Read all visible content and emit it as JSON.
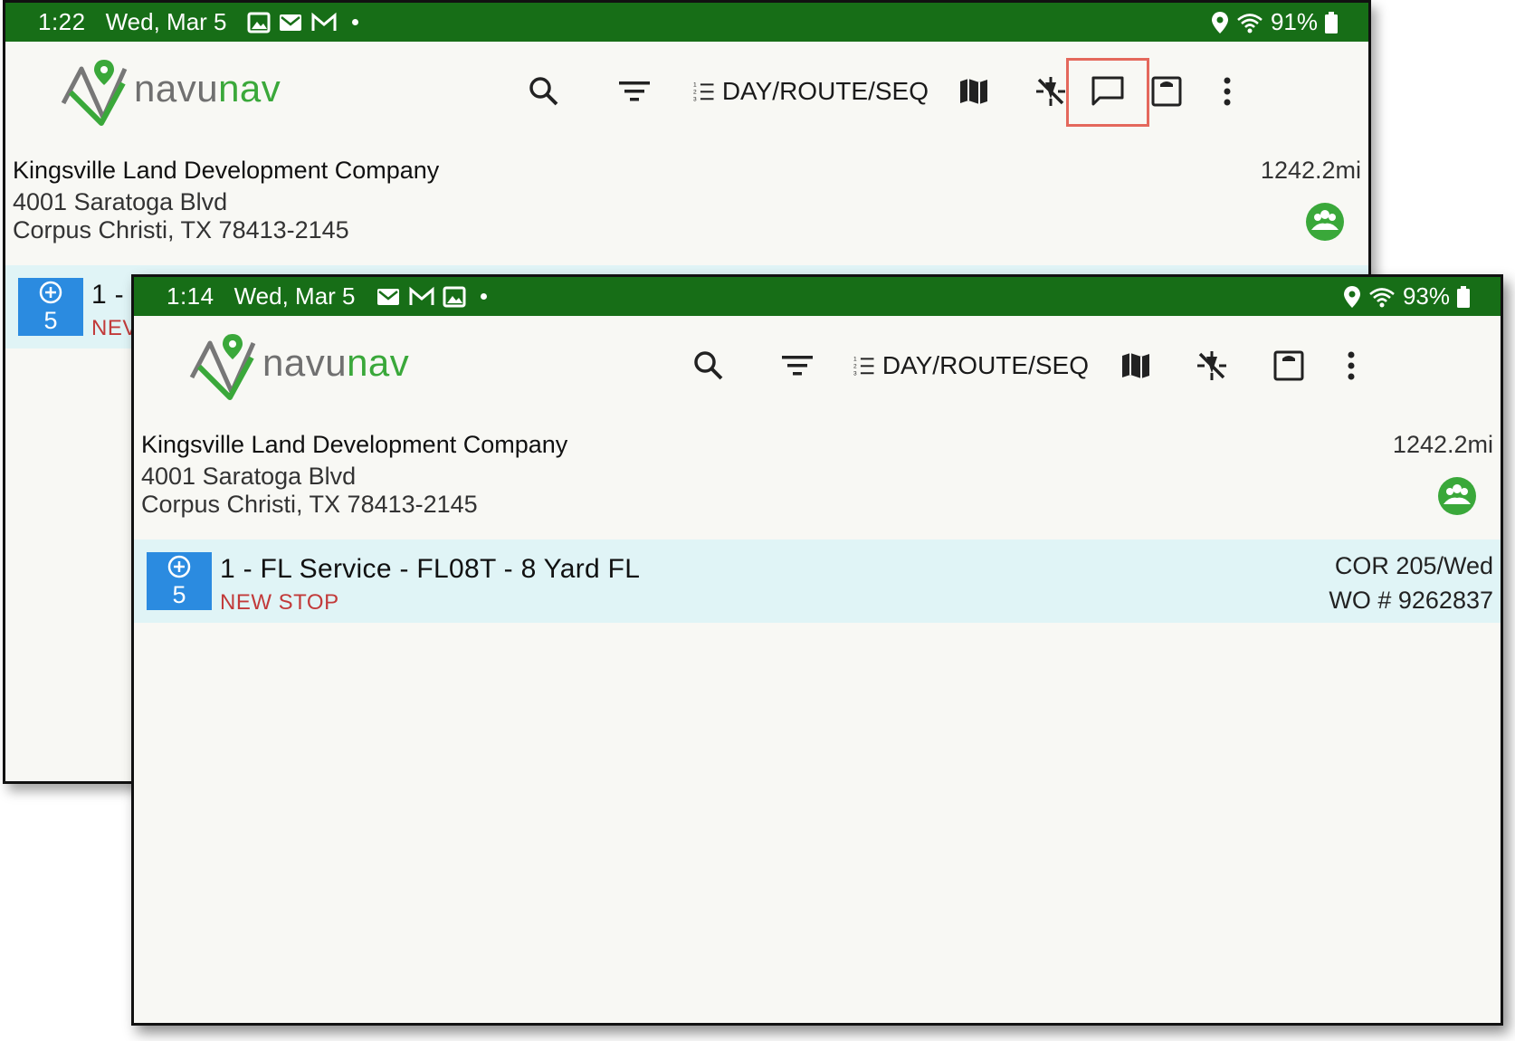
{
  "back": {
    "status": {
      "time": "1:22",
      "date": "Wed, Mar 5",
      "battery": "91%"
    },
    "logo": {
      "part1": "navu",
      "part2": "nav"
    },
    "sort_label": "DAY/ROUTE/SEQ",
    "customer": {
      "name": "Kingsville Land Development Company",
      "address1": "4001 Saratoga Blvd",
      "address2": "Corpus Christi, TX 78413-2145",
      "distance": "1242.2mi"
    },
    "stop": {
      "badge_count": "5",
      "title_partial": "1 -",
      "status_partial": "NEV"
    }
  },
  "front": {
    "status": {
      "time": "1:14",
      "date": "Wed, Mar 5",
      "battery": "93%"
    },
    "logo": {
      "part1": "navu",
      "part2": "nav"
    },
    "sort_label": "DAY/ROUTE/SEQ",
    "customer": {
      "name": "Kingsville Land Development Company",
      "address1": "4001 Saratoga Blvd",
      "address2": "Corpus Christi, TX 78413-2145",
      "distance": "1242.2mi"
    },
    "stop": {
      "badge_count": "5",
      "title": "1 - FL Service - FL08T - 8 Yard FL",
      "status": "NEW STOP",
      "route": "COR 205/Wed",
      "work_order": "WO # 9262837"
    }
  },
  "colors": {
    "status_bar": "#176e17",
    "brand_green": "#3aa83a",
    "badge_blue": "#2b8be0",
    "stop_row": "#e0f4f6",
    "new_stop_red": "#c23a3a",
    "highlight": "#e4685c"
  },
  "icons": [
    "image-icon",
    "email-icon",
    "gmail-icon",
    "location-icon",
    "wifi-icon",
    "battery-icon",
    "search-icon",
    "filter-icon",
    "sort-numeric-icon",
    "map-icon",
    "gps-off-icon",
    "message-icon",
    "timeclock-icon",
    "more-vert-icon",
    "group-icon",
    "add-circle-icon"
  ]
}
